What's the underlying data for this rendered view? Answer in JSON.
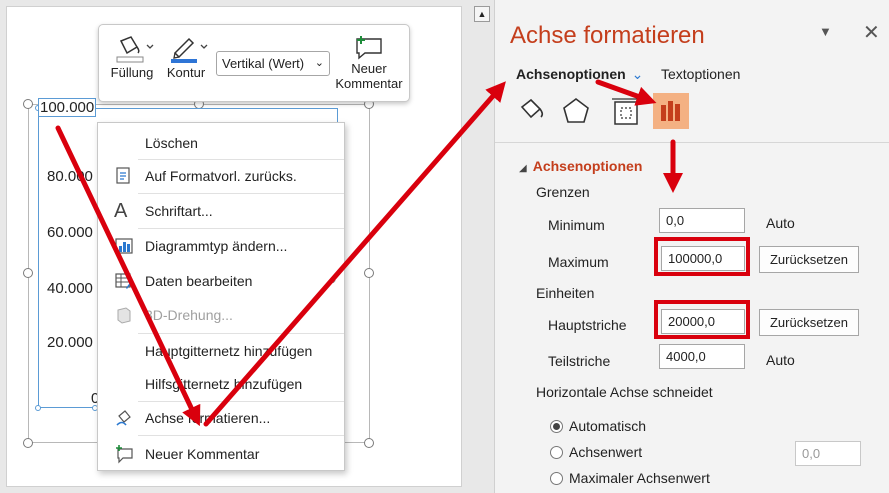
{
  "chart": {
    "axis_labels": [
      "100.000",
      "80.000",
      "60.000",
      "40.000",
      "20.000",
      "0"
    ]
  },
  "mini_toolbar": {
    "fill_label": "Füllung",
    "outline_label": "Kontur",
    "select_value": "Vertikal (Wert)",
    "comment_label_line1": "Neuer",
    "comment_label_line2": "Kommentar"
  },
  "context_menu": {
    "items": [
      {
        "label": "Löschen",
        "icon": "none",
        "disabled": false
      },
      {
        "label": "Auf Formatvorl. zurücks.",
        "icon": "reset-style-icon",
        "disabled": false
      },
      {
        "label": "Schriftart...",
        "icon": "font-icon",
        "disabled": false
      },
      {
        "label": "Diagrammtyp ändern...",
        "icon": "chart-type-icon",
        "disabled": false
      },
      {
        "label": "Daten bearbeiten",
        "icon": "edit-data-icon",
        "disabled": false
      },
      {
        "label": "3D-Drehung...",
        "icon": "rotation-3d-icon",
        "disabled": true
      },
      {
        "label": "Hauptgitternetz hinzufügen",
        "icon": "none",
        "disabled": false
      },
      {
        "label": "Hilfsgitternetz hinzufügen",
        "icon": "none",
        "disabled": false
      },
      {
        "label": "Achse formatieren...",
        "icon": "format-axis-icon",
        "disabled": false
      },
      {
        "label": "Neuer Kommentar",
        "icon": "comment-icon",
        "disabled": false
      }
    ]
  },
  "pane": {
    "title": "Achse formatieren",
    "tab_axis_options": "Achsenoptionen",
    "tab_text_options": "Textoptionen",
    "section_title": "Achsenoptionen",
    "bounds_label": "Grenzen",
    "minimum_label": "Minimum",
    "minimum_value": "0,0",
    "minimum_status": "Auto",
    "maximum_label": "Maximum",
    "maximum_value": "100000,0",
    "maximum_reset": "Zurücksetzen",
    "units_label": "Einheiten",
    "major_label": "Hauptstriche",
    "major_value": "20000,0",
    "major_reset": "Zurücksetzen",
    "minor_label": "Teilstriche",
    "minor_value": "4000,0",
    "minor_status": "Auto",
    "crosses_label": "Horizontale Achse schneidet",
    "radio_auto": "Automatisch",
    "radio_axis_value": "Achsenwert",
    "axis_value_input": "0,0",
    "radio_max_axis": "Maximaler Achsenwert"
  },
  "colors": {
    "accent": "#c43e1c",
    "highlight": "#d9000d",
    "selected_icon_bg": "#f4b183"
  }
}
